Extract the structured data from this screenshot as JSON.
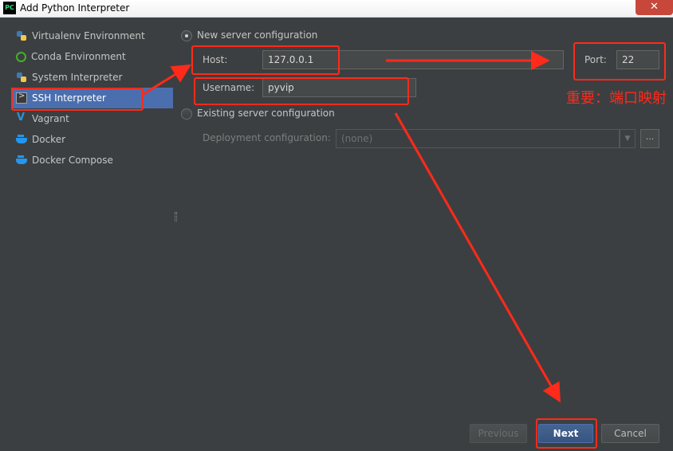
{
  "window": {
    "title": "Add Python Interpreter",
    "app_icon_text": "PC",
    "close_glyph": "✕"
  },
  "nav": {
    "items": [
      {
        "label": "Virtualenv Environment",
        "icon": "python-icon"
      },
      {
        "label": "Conda Environment",
        "icon": "conda-icon"
      },
      {
        "label": "System Interpreter",
        "icon": "python-icon"
      },
      {
        "label": "SSH Interpreter",
        "icon": "terminal-icon",
        "selected": true
      },
      {
        "label": "Vagrant",
        "icon": "vagrant-icon"
      },
      {
        "label": "Docker",
        "icon": "docker-icon"
      },
      {
        "label": "Docker Compose",
        "icon": "docker-icon"
      }
    ]
  },
  "form": {
    "new_config_label": "New server configuration",
    "host_label": "Host:",
    "host_value": "127.0.0.1",
    "port_label": "Port:",
    "port_value": "22",
    "username_label": "Username:",
    "username_value": "pyvip",
    "existing_config_label": "Existing server configuration",
    "deployment_label": "Deployment configuration:",
    "deployment_value": "(none)",
    "deployment_browse": "..."
  },
  "buttons": {
    "previous": "Previous",
    "next": "Next",
    "cancel": "Cancel"
  },
  "annotation": {
    "note": "重要：端口映射",
    "color": "#ff2a1a"
  },
  "colors": {
    "background": "#3c3f41",
    "selection": "#4b6eaf"
  }
}
